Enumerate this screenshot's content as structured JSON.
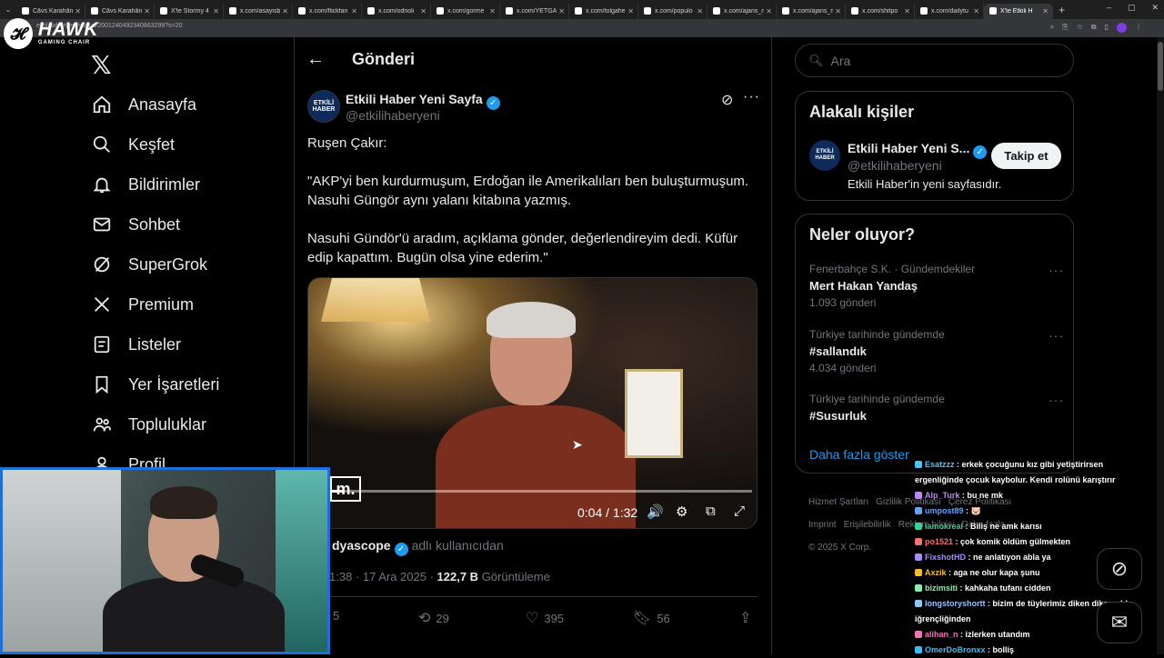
{
  "browser": {
    "tabs": [
      "Cāvs Karahānl",
      "Cāvs Karahānl",
      "X'te Stormy 4",
      "x.com/asayisb",
      "x.com/flickfan",
      "x.com/odnoli",
      "x.com/gorme",
      "x.com/YETGAH",
      "x.com/tolgahe",
      "x.com/populo",
      "x.com/ajans_m",
      "x.com/ajans_m",
      "x.com/shitpo",
      "x.com/dailytu",
      "X'te Etkili H"
    ],
    "active_tab_index": 14,
    "url": "etkilihaberyeni/status/2001240492340863299?s=20"
  },
  "overlay_logo": {
    "brand": "HAWK",
    "sub": "GAMING CHAIR"
  },
  "nav": {
    "items": [
      {
        "label": "Anasayfa",
        "icon": "home-icon"
      },
      {
        "label": "Keşfet",
        "icon": "search-icon"
      },
      {
        "label": "Bildirimler",
        "icon": "bell-icon"
      },
      {
        "label": "Sohbet",
        "icon": "mail-icon"
      },
      {
        "label": "SuperGrok",
        "icon": "grok-icon"
      },
      {
        "label": "Premium",
        "icon": "x-icon"
      },
      {
        "label": "Listeler",
        "icon": "list-icon"
      },
      {
        "label": "Yer İşaretleri",
        "icon": "bookmark-icon"
      },
      {
        "label": "Topluluklar",
        "icon": "people-icon"
      },
      {
        "label": "Profil",
        "icon": "profile-icon"
      }
    ]
  },
  "header": {
    "title": "Gönderi"
  },
  "post": {
    "avatar_text": "ETKİLİ HABER",
    "author_name": "Etkili Haber Yeni Sayfa",
    "author_handle": "@etkilihaberyeni",
    "text_lines": [
      "Ruşen Çakır:",
      "\"AKP'yi ben kurdurmuşum, Erdoğan ile Amerikalıları ben buluşturmuşum. Nasuhi Güngör aynı yalanı kitabına yazmış.",
      "Nasuhi Gündör'ü aradım, açıklama gönder, değerlendireyim dedi. Küfür edip kapattım. Bugün olsa yine ederim.\""
    ],
    "video": {
      "logo": "m.",
      "time": "0:04 / 1:32",
      "progress": 0.043
    },
    "attribution_name": "dyascope",
    "attribution_rest": "adlı kullanıcıdan",
    "time": "1:38 · 17 Ara 2025 · ",
    "views": "122,7 B",
    "views_label": " Görüntüleme",
    "actions": {
      "replies": "5",
      "reposts": "29",
      "likes": "395",
      "bookmarks": "56"
    }
  },
  "search": {
    "placeholder": "Ara"
  },
  "related": {
    "title": "Alakalı kişiler",
    "avatar_text": "ETKİLİ HABER",
    "name": "Etkili Haber Yeni S...",
    "handle": "@etkilihaberyeni",
    "bio": "Etkili Haber'in yeni sayfasıdır.",
    "follow_label": "Takip et"
  },
  "trends": {
    "title": "Neler oluyor?",
    "items": [
      {
        "context": "Fenerbahçe S.K. · Gündemdekiler",
        "title": "Mert Hakan Yandaş",
        "count": "1.093 gönderi"
      },
      {
        "context": "Türkiye tarihinde gündemde",
        "title": "#sallandık",
        "count": "4.034 gönderi"
      },
      {
        "context": "Türkiye tarihinde gündemde",
        "title": "#Susurluk",
        "count": ""
      }
    ],
    "show_more": "Daha fazla göster"
  },
  "footer": {
    "links": [
      "Hizmet Şartları",
      "Gizlilik Politikası",
      "Çerez Politikası",
      "Imprint",
      "Erişilebilirlik",
      "Reklam bilgisi",
      "Daha fazla ..."
    ],
    "copyright": "© 2025 X Corp."
  },
  "chat": [
    {
      "user": "Esatzzz",
      "color": "#4fc3f7",
      "text": "erkek çocuğunu kız gibi yetiştirirsen ergenliğinde çocuk kaybolur. Kendi rolünü karıştırır"
    },
    {
      "user": "Alp_Turk",
      "color": "#c084fc",
      "text": "bu ne mk"
    },
    {
      "user": "umpost89",
      "color": "#60a5fa",
      "text": "🐷"
    },
    {
      "user": "iamokreal",
      "color": "#34d399",
      "text": "Biliş ne amk karısı"
    },
    {
      "user": "po1521",
      "color": "#f87171",
      "text": "çok komik öldüm gülmekten"
    },
    {
      "user": "FixshotHD",
      "color": "#a78bfa",
      "text": "ne anlatıyon abla ya"
    },
    {
      "user": "Axzik",
      "color": "#fbbf24",
      "text": "aga ne olur kapa şunu"
    },
    {
      "user": "bizimsiti",
      "color": "#86efac",
      "text": "kahkaha tufanı cidden"
    },
    {
      "user": "longstoryshortt",
      "color": "#93c5fd",
      "text": "bizim de tüylerimiz diken diken oldu iğrençliğinden"
    },
    {
      "user": "alihan_n",
      "color": "#f472b6",
      "text": "izlerken utandım"
    },
    {
      "user": "OmerDoBronxx",
      "color": "#38bdf8",
      "text": "bolliş"
    }
  ]
}
